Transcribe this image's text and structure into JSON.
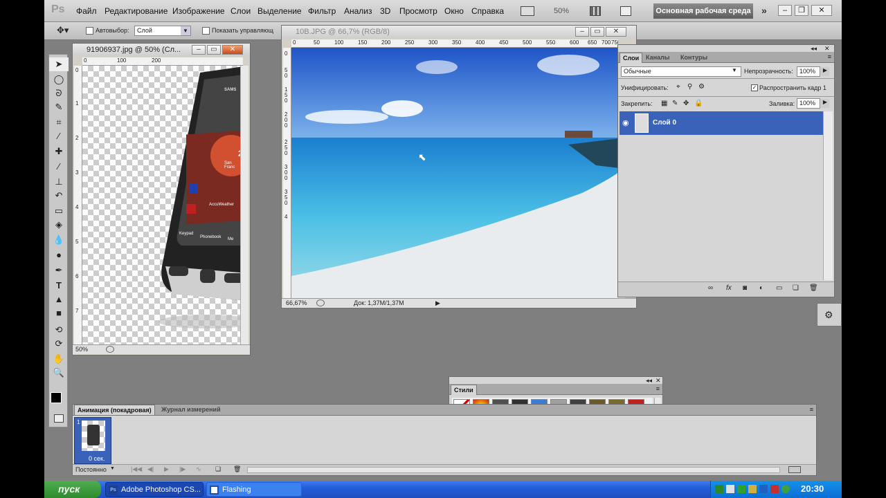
{
  "app": {
    "logo": "Ps",
    "menu": [
      "Файл",
      "Редактирование",
      "Изображение",
      "Слои",
      "Выделение",
      "Фильтр",
      "Анализ",
      "3D",
      "Просмотр",
      "Окно",
      "Справка"
    ],
    "zoom": "50%",
    "workspace": "Основная рабочая среда"
  },
  "options": {
    "autoselect_label": "Автовыбор:",
    "autoselect_value": "Слой",
    "show_controls_label": "Показать управляющ"
  },
  "doc1": {
    "title": "91906937.jpg @ 50% (Сл...",
    "ruler_h": [
      "0",
      "100",
      "200"
    ],
    "ruler_v": [
      "0",
      "1",
      "2",
      "3",
      "4",
      "5",
      "6",
      "7",
      "8"
    ],
    "zoom": "50%",
    "phone": {
      "brand": "SAMS",
      "city": "San Franc",
      "weather": "AccuWeather",
      "temp": "25",
      "keys": [
        "Keypad",
        "Phonebook",
        "Me"
      ]
    }
  },
  "doc2": {
    "title": "10B.JPG @ 66,7% (RGB/8)",
    "ruler_h": [
      "0",
      "50",
      "100",
      "150",
      "200",
      "250",
      "300",
      "350",
      "400",
      "450",
      "500",
      "550",
      "600",
      "650",
      "700",
      "750"
    ],
    "ruler_v": [
      "0",
      "5",
      "0",
      "1",
      "5",
      "0",
      "2",
      "0",
      "0",
      "2",
      "5",
      "0",
      "3",
      "0",
      "0",
      "3",
      "5",
      "0",
      "4"
    ],
    "zoom": "66,67%",
    "doc_info": "Док: 1,37M/1,37M"
  },
  "layers_panel": {
    "tabs": [
      "Слои",
      "Каналы",
      "Контуры"
    ],
    "blend_mode": "Обычные",
    "opacity_label": "Непрозрачность:",
    "opacity": "100%",
    "unify_label": "Унифицировать:",
    "propagate_label": "Распространить кадр 1",
    "lock_label": "Закрепить:",
    "fill_label": "Заливка:",
    "fill": "100%",
    "layer_name": "Слой 0"
  },
  "styles_panel": {
    "title": "Стили",
    "swatch_colors": [
      "#ffffff",
      "#e05010",
      "#505050",
      "#303030",
      "#3a7bd5",
      "#a0a0a0",
      "#404040",
      "#6b5a2a",
      "#7a6a30",
      "#c02020",
      "#1a6a3a",
      "#d4d000",
      "#b87333",
      "#9ac8f0",
      "#7090b0",
      "#e0e0e0",
      "#4040a0",
      "#555555",
      "#f0f0f0",
      "#444444"
    ]
  },
  "animation_panel": {
    "tabs": [
      "Анимация (покадровая)",
      "Журнал измерений"
    ],
    "frame_number": "1",
    "frame_delay": "0 сек.",
    "loop": "Постоянно"
  },
  "taskbar": {
    "start": "пуск",
    "items": [
      "Adobe Photoshop CS...",
      "Flashing"
    ],
    "time": "20:30"
  }
}
